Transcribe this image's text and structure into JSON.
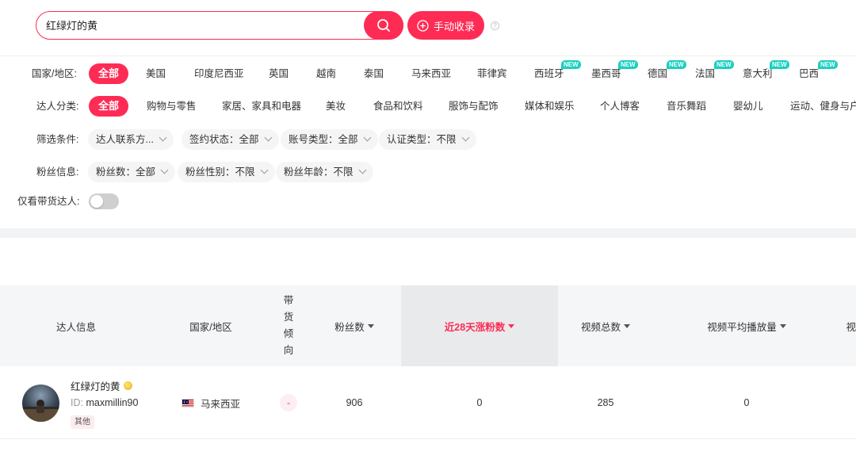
{
  "search": {
    "value": "红绿灯的黄",
    "manual_label": "手动收录",
    "help": "?"
  },
  "filters": {
    "country": {
      "label": "国家/地区:",
      "all": "全部",
      "options": [
        "美国",
        "印度尼西亚",
        "英国",
        "越南",
        "泰国",
        "马来西亚",
        "菲律宾",
        "西班牙",
        "墨西哥",
        "德国",
        "法国",
        "意大利",
        "巴西"
      ],
      "new_badge": "NEW"
    },
    "category": {
      "label": "达人分类:",
      "all": "全部",
      "options": [
        "购物与零售",
        "家居、家具和电器",
        "美妆",
        "食品和饮料",
        "服饰与配饰",
        "媒体和娱乐",
        "个人博客",
        "音乐舞蹈",
        "婴幼儿",
        "运动、健身与户"
      ]
    },
    "conditions": {
      "label": "筛选条件:",
      "dropdowns": [
        "达人联系方...",
        "签约状态：全部",
        "账号类型：全部",
        "认证类型：不限"
      ]
    },
    "fans": {
      "label": "粉丝信息:",
      "dropdowns": [
        "粉丝数：全部",
        "粉丝性别：不限",
        "粉丝年龄：不限"
      ]
    },
    "only_seller": {
      "label": "仅看带货达人:",
      "enabled": false
    }
  },
  "table": {
    "headers": {
      "info": "达人信息",
      "country": "国家/地区",
      "tendency": [
        "带",
        "货",
        "倾",
        "向"
      ],
      "fans": "粉丝数",
      "growth28": "近28天涨粉数",
      "videos": "视频总数",
      "avg_play": "视频平均播放量",
      "more": "视"
    },
    "rows": [
      {
        "name": "红绿灯的黄",
        "id_prefix": "ID:",
        "id": "maxmillin90",
        "tag": "其他",
        "country": "马来西亚",
        "tendency": "-",
        "fans": "906",
        "growth28": "0",
        "videos": "285",
        "avg_play": "0"
      }
    ]
  },
  "colors": {
    "accent": "#fe2c55",
    "new_badge": "#19d0c0"
  }
}
